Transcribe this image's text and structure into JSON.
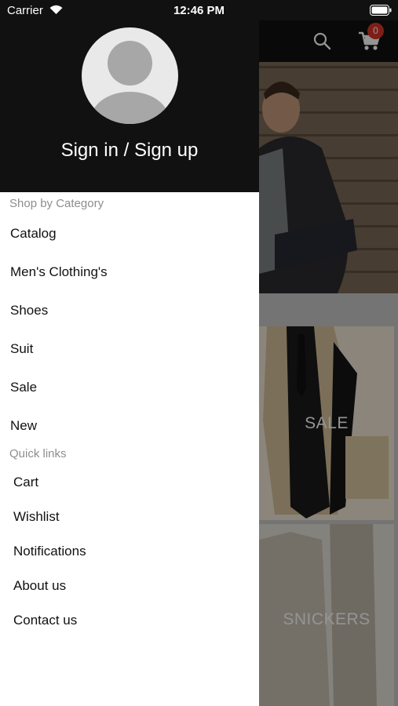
{
  "status_bar": {
    "carrier": "Carrier",
    "time": "12:46 PM"
  },
  "drawer": {
    "signin_label": "Sign in / Sign up",
    "shop_section_title": "Shop by Category",
    "categories": [
      "Catalog",
      "Men's Clothing's",
      "Shoes",
      "Suit",
      "Sale",
      "New"
    ],
    "quick_links_title": "Quick links",
    "quick_links": [
      "Cart",
      "Wishlist",
      "Notifications",
      "About us",
      "Contact us"
    ]
  },
  "background_app": {
    "cart_count": "0",
    "category_cards": [
      "SALE",
      "SNICKERS"
    ]
  },
  "colors": {
    "header_bg": "#111111",
    "badge": "#d9352a",
    "section_title": "#8e8e8e"
  }
}
